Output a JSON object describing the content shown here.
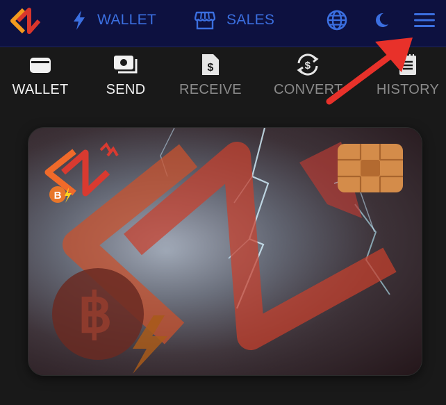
{
  "nav": {
    "wallet_label": "WALLET",
    "sales_label": "SALES"
  },
  "toolbar": {
    "items": [
      {
        "label": "WALLET",
        "icon": "wallet-icon",
        "active": true
      },
      {
        "label": "SEND",
        "icon": "send-money-icon",
        "active": true
      },
      {
        "label": "RECEIVE",
        "icon": "receive-invoice-icon",
        "active": false
      },
      {
        "label": "CONVERT",
        "icon": "convert-dollar-icon",
        "active": false
      },
      {
        "label": "HISTORY",
        "icon": "history-receipt-icon",
        "active": false
      }
    ]
  },
  "card": {
    "logo_badge": "B"
  },
  "colors": {
    "navbar_bg": "#0d1140",
    "nav_accent": "#3b6fe0",
    "page_bg": "#191919",
    "brand_orange": "#f0622d",
    "brand_red": "#c8302a",
    "annotation_arrow": "#e8312a"
  }
}
